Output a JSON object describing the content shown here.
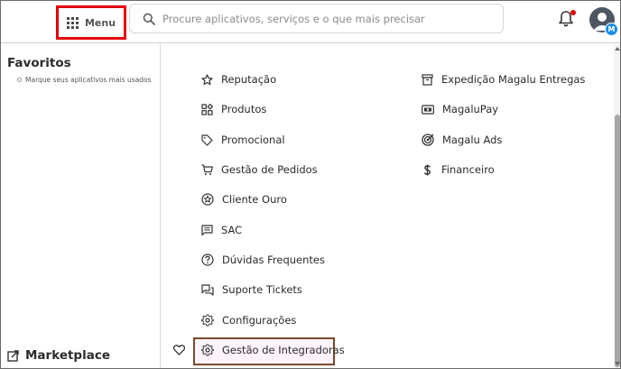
{
  "header": {
    "menu_label": "Menu",
    "search_placeholder": "Procure aplicativos, serviços e o que mais precisar",
    "avatar_badge": "M",
    "colors": {
      "highlight_red": "#e3000f",
      "badge_blue": "#1a8de8"
    }
  },
  "sidebar": {
    "favorites_title": "Favoritos",
    "favorites_hint": "Marque seus aplicativos mais usados",
    "section_title": "Marketplace"
  },
  "menu_left": [
    {
      "label": "Reputação",
      "icon": "star-icon"
    },
    {
      "label": "Produtos",
      "icon": "apps-icon"
    },
    {
      "label": "Promocional",
      "icon": "tag-icon"
    },
    {
      "label": "Gestão de Pedidos",
      "icon": "cart-icon"
    },
    {
      "label": "Cliente Ouro",
      "icon": "badge-star-icon"
    },
    {
      "label": "SAC",
      "icon": "chat-icon"
    },
    {
      "label": "Dúvidas Frequentes",
      "icon": "help-icon"
    },
    {
      "label": "Suporte Tickets",
      "icon": "forum-icon"
    },
    {
      "label": "Configurações",
      "icon": "gear-icon"
    },
    {
      "label": "Gestão de Integradoras",
      "icon": "gear-icon"
    }
  ],
  "menu_right": [
    {
      "label": "Expedição Magalu Entregas",
      "icon": "archive-icon"
    },
    {
      "label": "MagaluPay",
      "icon": "payment-icon"
    },
    {
      "label": "Magalu Ads",
      "icon": "target-icon"
    },
    {
      "label": "Financeiro",
      "icon": "dollar-icon"
    }
  ]
}
